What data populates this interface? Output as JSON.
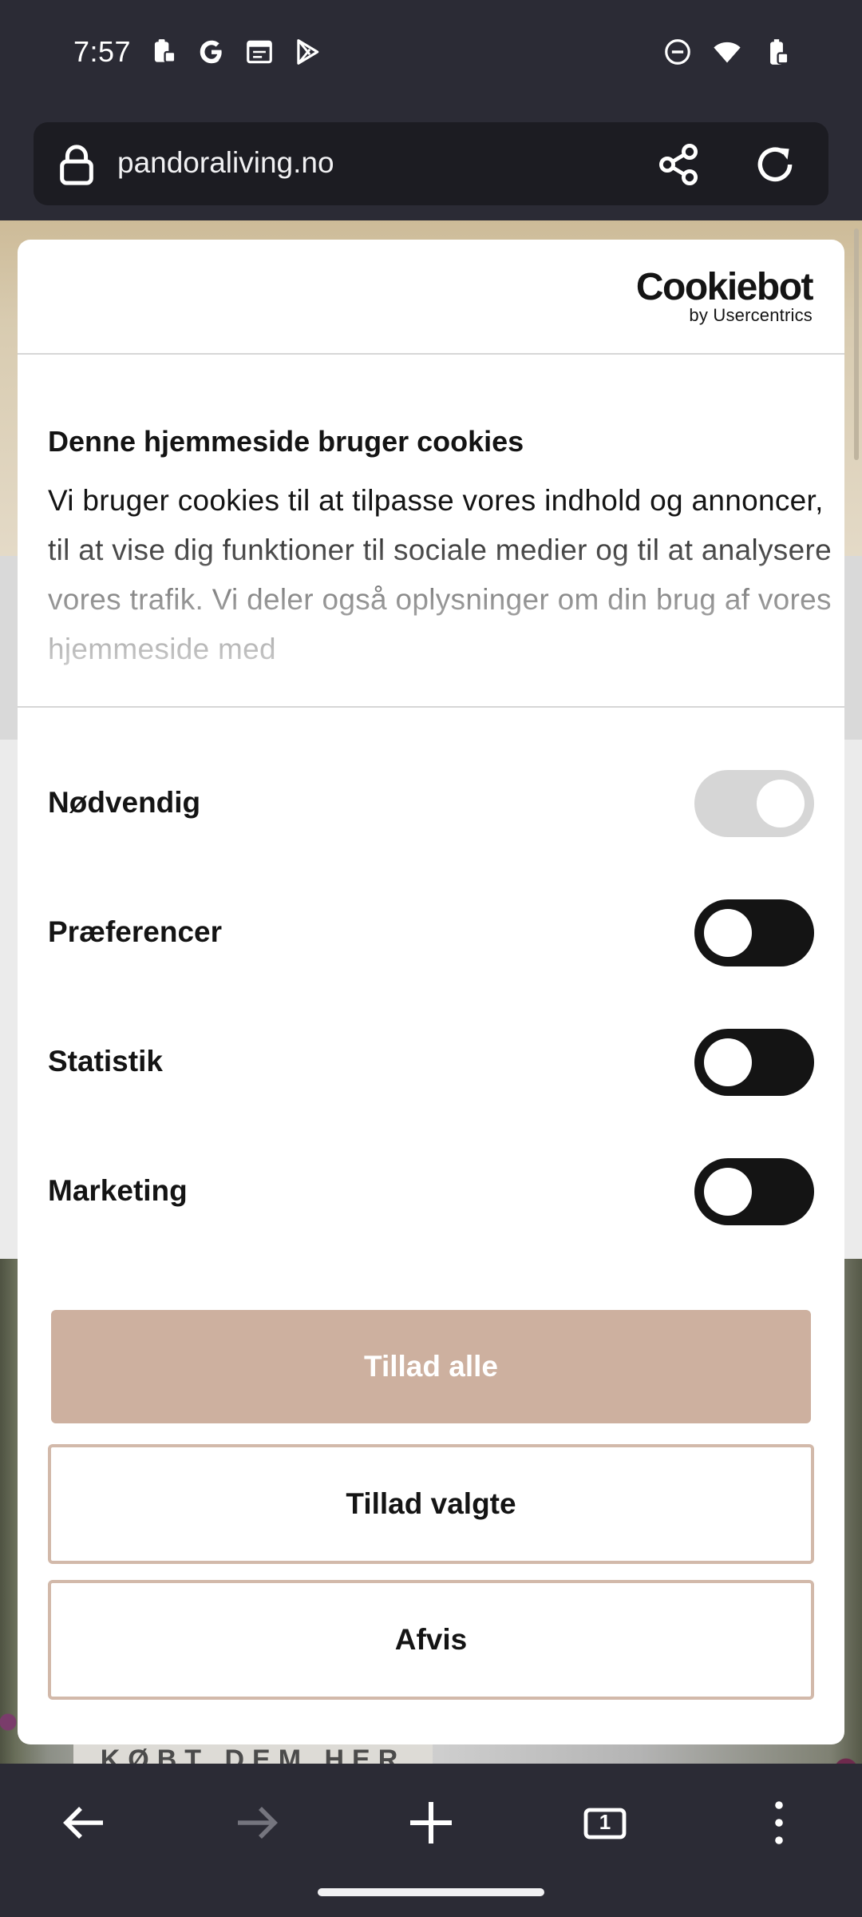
{
  "status_bar": {
    "time": "7:57",
    "left_icons": [
      "clipboard-lock-icon",
      "google-icon",
      "calendar-icon",
      "play-store-icon"
    ],
    "right_icons": [
      "do-not-disturb-icon",
      "wifi-icon",
      "battery-icon"
    ]
  },
  "url_bar": {
    "url": "pandoraliving.no",
    "icons": [
      "lock-icon",
      "share-icon",
      "reload-icon"
    ]
  },
  "page_background": {
    "banner_text": "KØBT DEM HER"
  },
  "consent_dialog": {
    "brand": {
      "name": "Cookiebot",
      "tagline": "by Usercentrics"
    },
    "title": "Denne hjemmeside bruger cookies",
    "description": "Vi bruger cookies til at tilpasse vores indhold og annoncer, til at vise dig funktioner til sociale medier og til at analysere vores trafik. Vi deler også oplysninger om din brug af vores hjemmeside med",
    "toggles": [
      {
        "label": "Nødvendig",
        "checked": true,
        "disabled": true
      },
      {
        "label": "Præferencer",
        "checked": false,
        "disabled": false
      },
      {
        "label": "Statistik",
        "checked": false,
        "disabled": false
      },
      {
        "label": "Marketing",
        "checked": false,
        "disabled": false
      }
    ],
    "buttons": {
      "allow_all": "Tillad alle",
      "allow_selected": "Tillad valgte",
      "deny": "Afvis"
    },
    "colors": {
      "primary_button": "#cdb09f",
      "outline_border": "#d2b9aa",
      "switch_on": "#141414",
      "switch_disabled": "#d6d6d6"
    }
  },
  "bottom_bar": {
    "tab_count": "1",
    "icons": [
      "back-arrow-icon",
      "forward-arrow-icon",
      "new-tab-plus-icon",
      "tab-switcher-icon",
      "more-menu-icon"
    ]
  }
}
